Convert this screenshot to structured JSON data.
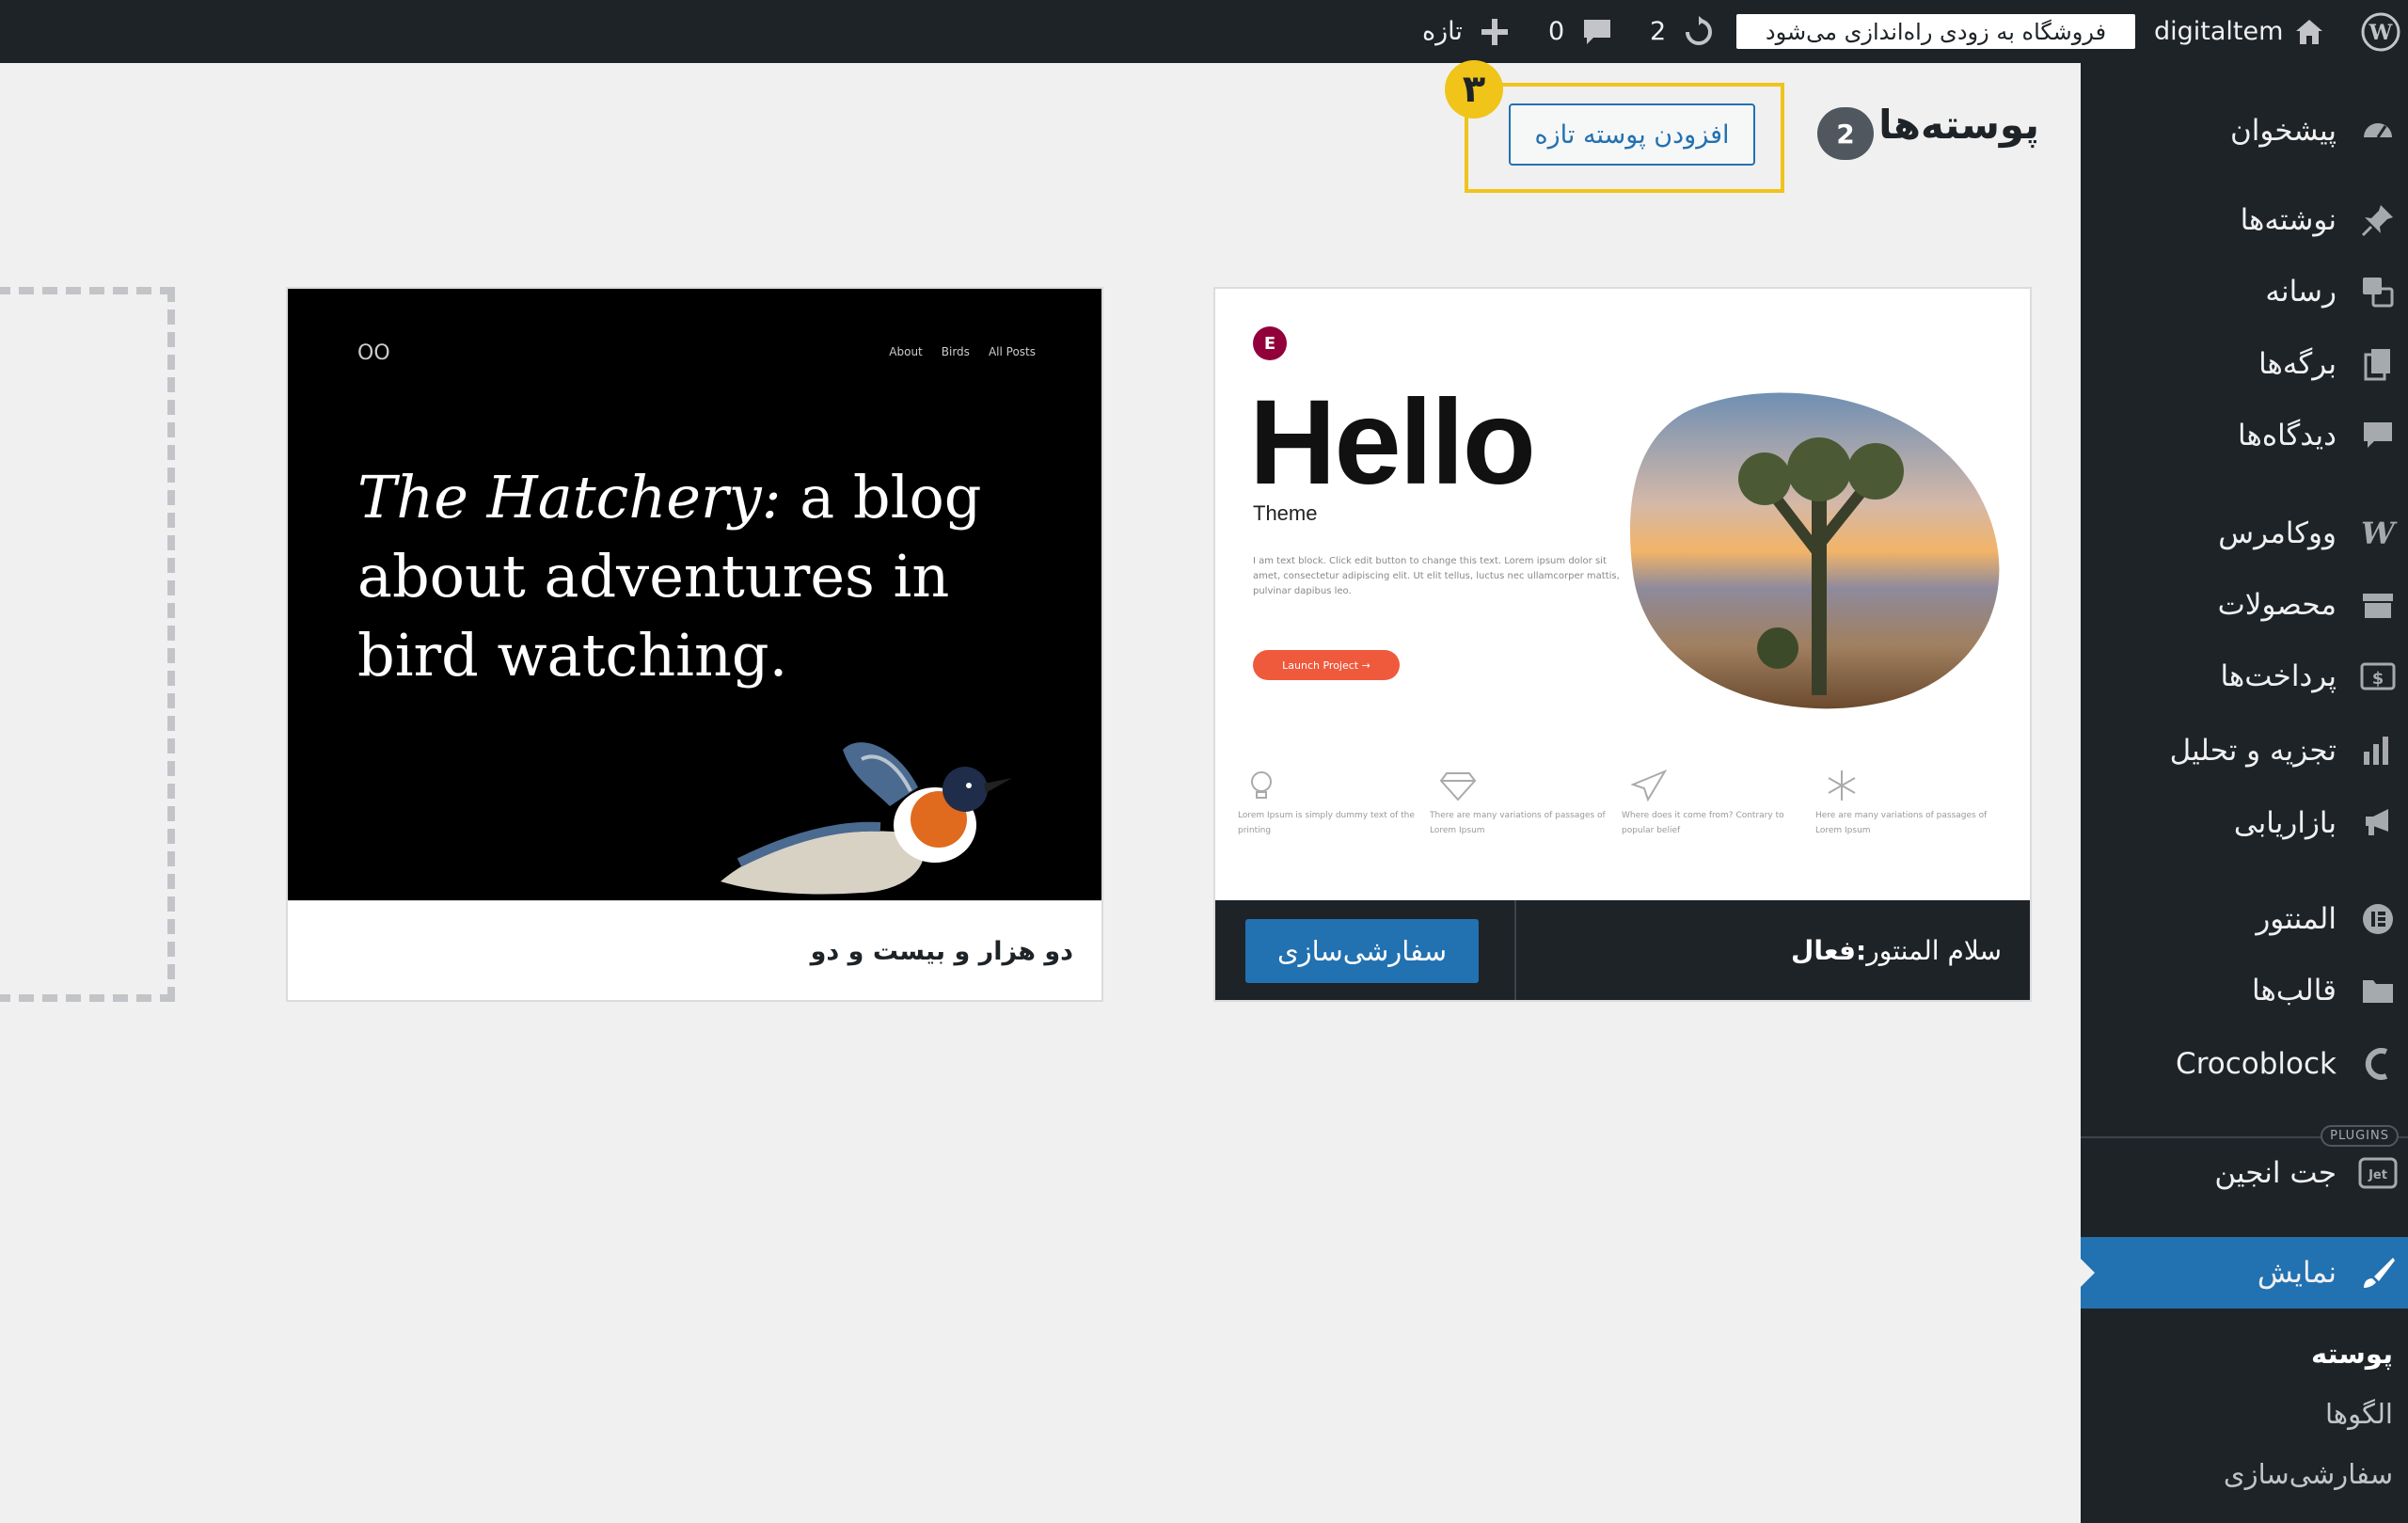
{
  "admin_bar": {
    "site_name": "digitaltem",
    "store_notice": "فروشگاه به زودی راه‌اندازی می‌شود",
    "updates_count": "2",
    "comments_count": "0",
    "new_label": "تازه"
  },
  "sidebar": {
    "items": [
      {
        "label": "پیشخوان",
        "icon": "dashboard-icon"
      },
      {
        "label": "نوشته‌ها",
        "icon": "pin-icon"
      },
      {
        "label": "رسانه",
        "icon": "media-icon"
      },
      {
        "label": "برگه‌ها",
        "icon": "pages-icon"
      },
      {
        "label": "دیدگاه‌ها",
        "icon": "comment-icon"
      },
      {
        "label": "ووکامرس",
        "icon": "woocommerce-icon"
      },
      {
        "label": "محصولات",
        "icon": "products-icon"
      },
      {
        "label": "پرداخت‌ها",
        "icon": "payments-icon"
      },
      {
        "label": "تجزیه و تحلیل",
        "icon": "analytics-icon"
      },
      {
        "label": "بازاریابی",
        "icon": "megaphone-icon"
      },
      {
        "label": "المنتور",
        "icon": "elementor-icon"
      },
      {
        "label": "قالب‌ها",
        "icon": "folder-icon"
      },
      {
        "label": "Crocoblock",
        "icon": "crocoblock-icon"
      },
      {
        "label": "جت انجین",
        "icon": "jet-icon"
      },
      {
        "label": "نمایش",
        "icon": "brush-icon"
      }
    ],
    "plugins_tag": "PLUGINS",
    "submenu": [
      {
        "label": "پوسته"
      },
      {
        "label": "الگوها"
      },
      {
        "label": "سفارشی‌سازی"
      }
    ]
  },
  "header": {
    "title": "پوسته‌ها",
    "count": "2",
    "add_new_label": "افزودن پوسته تازه",
    "step_number": "۳"
  },
  "themes": [
    {
      "status_label": "فعال:",
      "name": "سلام المنتور",
      "action_label": "سفارشی‌سازی",
      "preview": {
        "logo": "E",
        "title": "Hello",
        "subtitle": "Theme",
        "body": "I am text block. Click edit button to change this text. Lorem ipsum dolor sit amet, consectetur adipiscing elit. Ut elit tellus, luctus nec ullamcorper mattis, pulvinar dapibus leo.",
        "button": "Launch Project →",
        "features": [
          {
            "icon": "lightbulb-icon",
            "text": "Lorem Ipsum is simply dummy text of the printing"
          },
          {
            "icon": "diamond-icon",
            "text": "There are many variations of passages of Lorem Ipsum"
          },
          {
            "icon": "paper-plane-icon",
            "text": "Where does it come from? Contrary to popular belief"
          },
          {
            "icon": "snowflake-icon",
            "text": "Here are many variations of passages of Lorem Ipsum"
          }
        ]
      }
    },
    {
      "name": "دو هزار و بیست و دو",
      "preview": {
        "logo": "OO",
        "nav": [
          "About",
          "Birds",
          "All Posts"
        ],
        "title_italic": "The Hatchery:",
        "title_rest": "a blog about adventures in bird watching."
      }
    }
  ],
  "colors": {
    "admin_dark": "#1d2327",
    "accent_blue": "#2271b1",
    "highlight_yellow": "#f0c419",
    "background": "#f0f0f1"
  }
}
